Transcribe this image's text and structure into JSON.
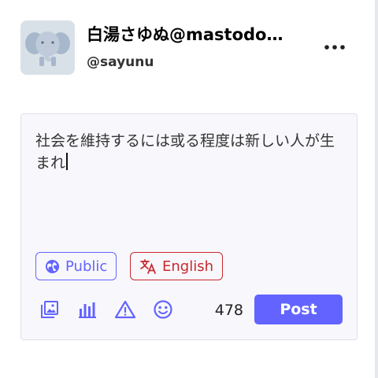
{
  "account": {
    "display_name": "白湯さゆぬ@mastodo…",
    "handle": "@sayunu",
    "avatar_icon": "elephant-avatar"
  },
  "header": {
    "more_icon": "more-horizontal-icon"
  },
  "compose": {
    "text": "社会を維持するには或る程度は新しい人が生まれ",
    "visibility_label": "Public",
    "visibility_icon": "globe-icon",
    "language_label": "English",
    "language_icon": "translate-icon",
    "char_count": "478",
    "post_label": "Post",
    "toolbar_icons": [
      "media-icon",
      "poll-icon",
      "content-warning-icon",
      "emoji-icon"
    ]
  },
  "colors": {
    "accent": "#6364ff",
    "language": "#c8282d",
    "compose_bg": "#f8f8fc"
  }
}
